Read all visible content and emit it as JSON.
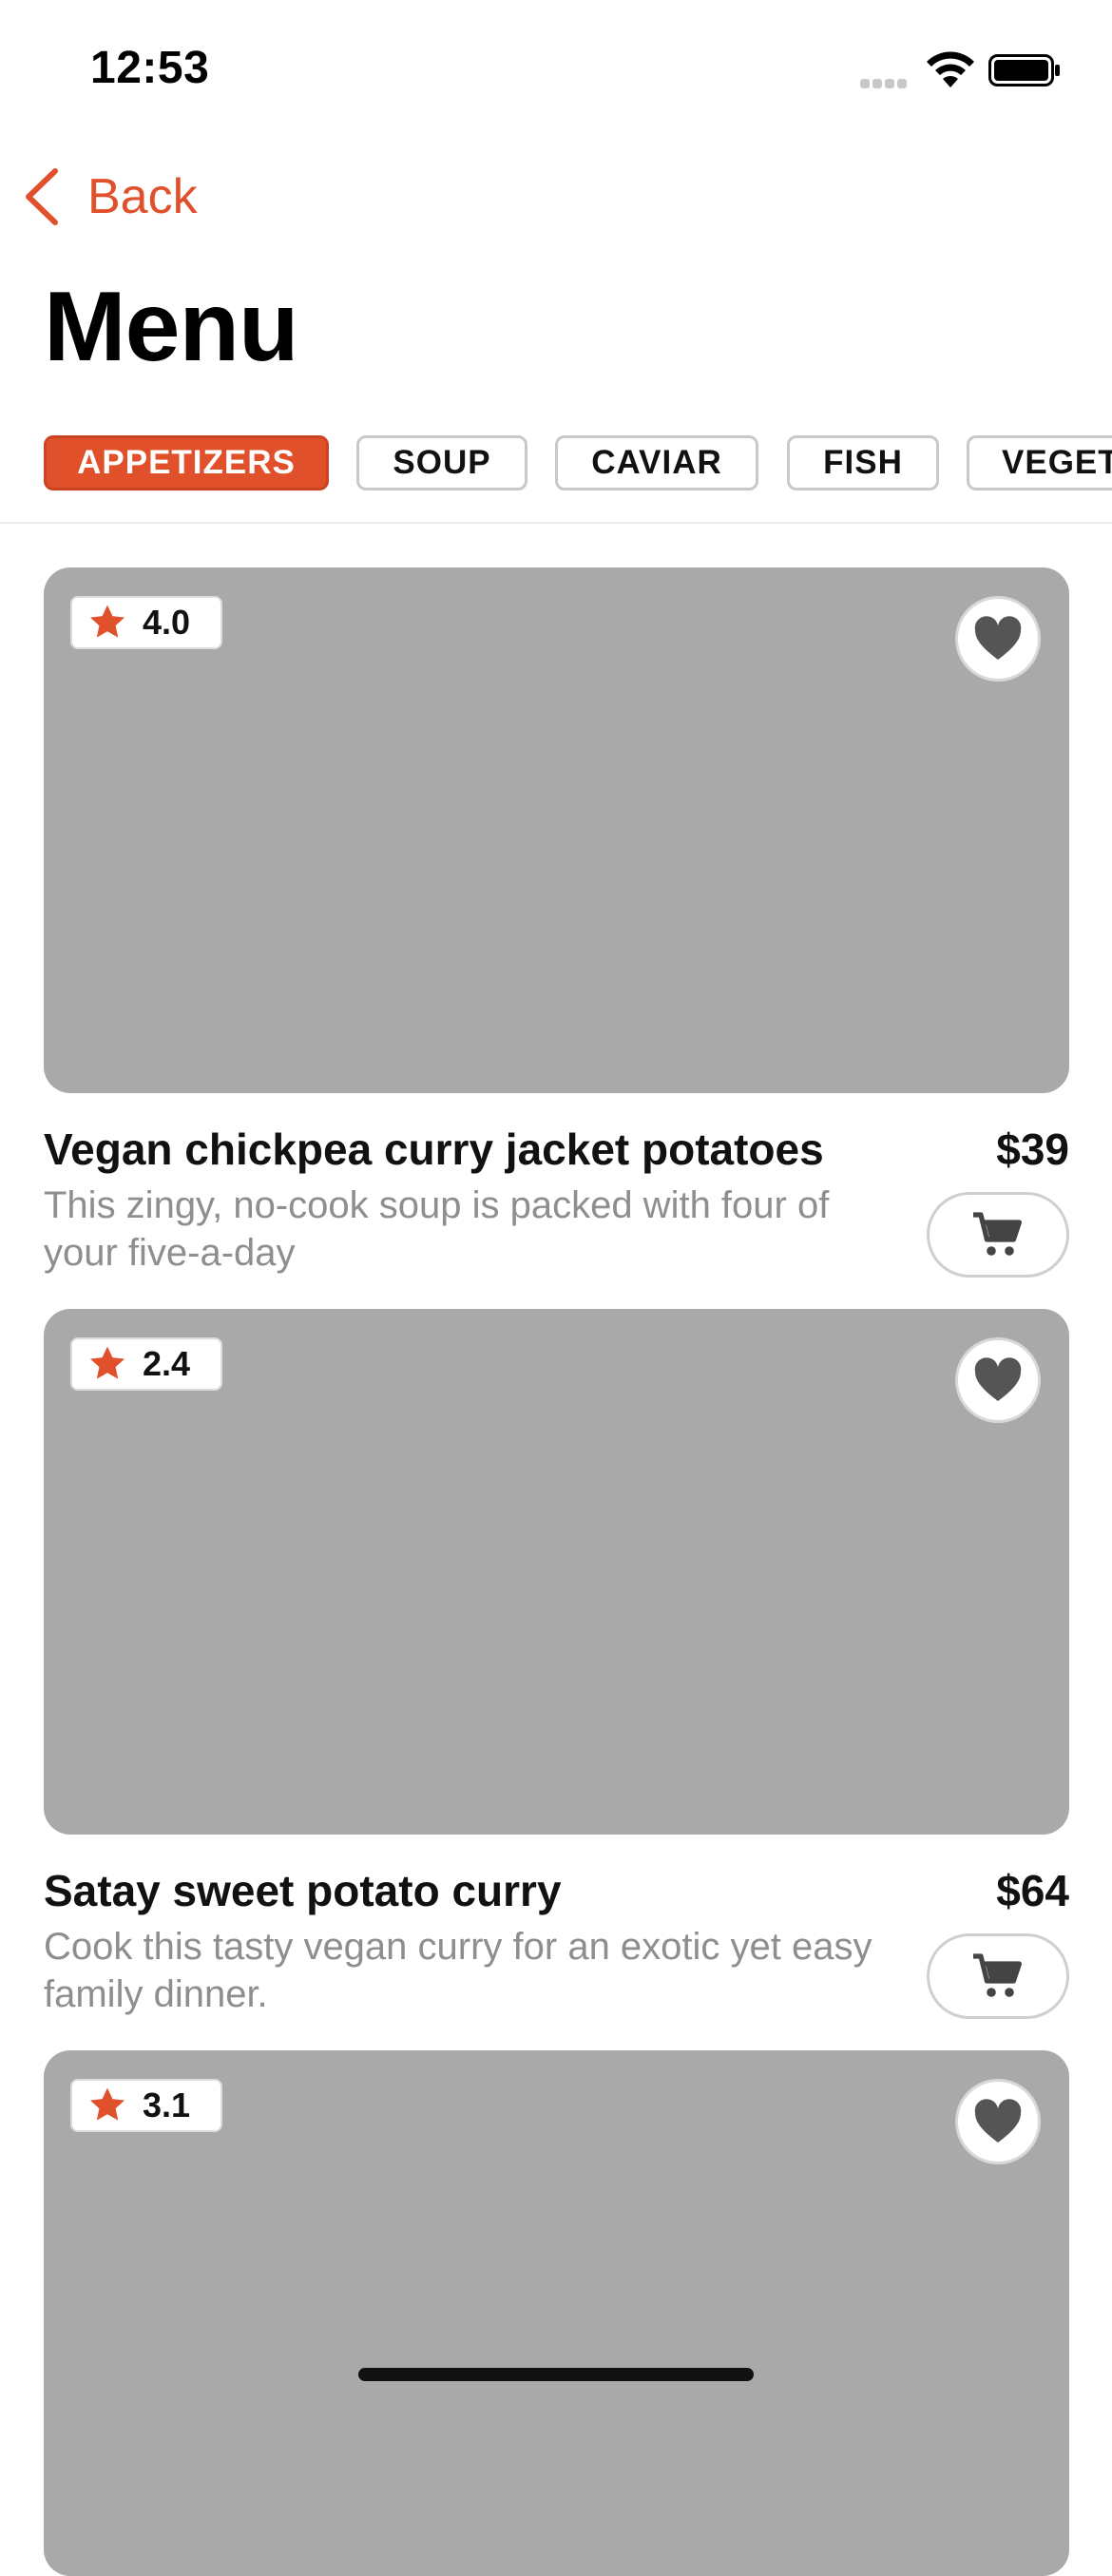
{
  "status_bar": {
    "time": "12:53"
  },
  "nav": {
    "back_label": "Back"
  },
  "page": {
    "title": "Menu"
  },
  "tabs": [
    {
      "label": "APPETIZERS",
      "active": true
    },
    {
      "label": "SOUP",
      "active": false
    },
    {
      "label": "CAVIAR",
      "active": false
    },
    {
      "label": "FISH",
      "active": false
    },
    {
      "label": "VEGET",
      "active": false
    }
  ],
  "items": [
    {
      "rating": "4.0",
      "name": "Vegan chickpea curry jacket potatoes",
      "price": "$39",
      "description": "This zingy, no-cook soup is packed with four of your five-a-day"
    },
    {
      "rating": "2.4",
      "name": "Satay sweet potato curry",
      "price": "$64",
      "description": "Cook this tasty vegan curry for an exotic yet easy family dinner."
    },
    {
      "rating": "3.1",
      "name": "",
      "price": "",
      "description": ""
    }
  ],
  "colors": {
    "accent": "#e0502b",
    "image_placeholder": "#a9a9a9",
    "secondary_text": "#8e8e8e"
  },
  "icons": [
    "back-chevron-icon",
    "star-icon",
    "heart-icon",
    "cart-icon",
    "wifi-icon",
    "battery-icon",
    "signal-icon"
  ]
}
